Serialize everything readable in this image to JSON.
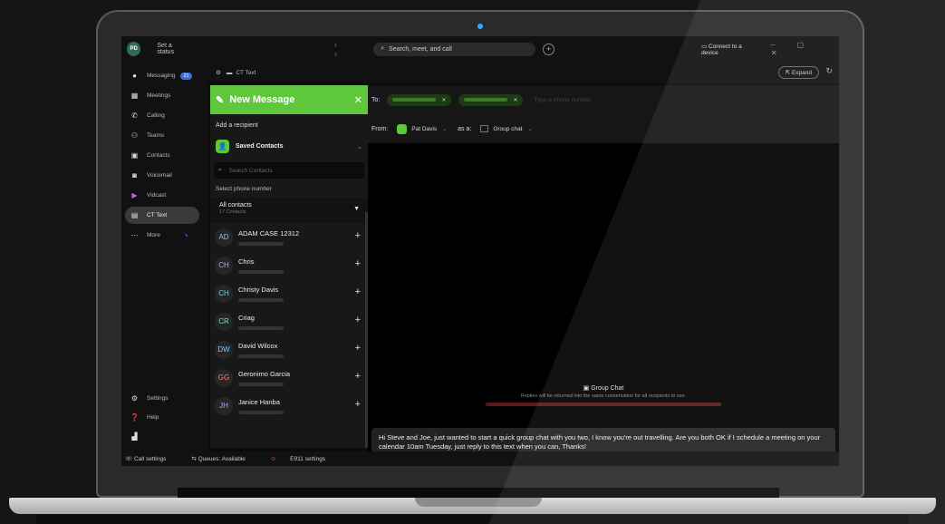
{
  "titlebar": {
    "avatar_initials": "PD",
    "status": "Set a status",
    "search_placeholder": "Search, meet, and call",
    "connect": "Connect to a device"
  },
  "nav": {
    "items": [
      {
        "label": "Messaging",
        "badge": "21"
      },
      {
        "label": "Meetings"
      },
      {
        "label": "Calling"
      },
      {
        "label": "Teams"
      },
      {
        "label": "Contacts"
      },
      {
        "label": "Voicemail"
      },
      {
        "label": "Vidcast"
      },
      {
        "label": "CT Text"
      },
      {
        "label": "More"
      }
    ],
    "settings": "Settings",
    "help": "Help"
  },
  "ctbar": {
    "title": "CT Text",
    "expand": "Expand"
  },
  "panel": {
    "title": "New Message",
    "add_recipient": "Add a recipient",
    "saved_contacts": "Saved Contacts",
    "search_placeholder": "Search Contacts",
    "select_phone": "Select phone number",
    "all_contacts": "All contacts",
    "contacts_count": "17 Contacts",
    "contacts": [
      {
        "initials": "AD",
        "name": "ADAM CASE 12312",
        "color": "#6fd0ff"
      },
      {
        "initials": "CH",
        "name": "Chris",
        "color": "#c79cff"
      },
      {
        "initials": "CH",
        "name": "Christy Davis",
        "color": "#6fd0ff"
      },
      {
        "initials": "CR",
        "name": "Criag",
        "color": "#7fe0c0"
      },
      {
        "initials": "DW",
        "name": "David Wilcox",
        "color": "#6fd0ff"
      },
      {
        "initials": "GG",
        "name": "Geronimo Garcia",
        "color": "#ff8080"
      },
      {
        "initials": "JH",
        "name": "Janice Hanba",
        "color": "#c79cff"
      }
    ]
  },
  "compose": {
    "to_label": "To:",
    "to_placeholder": "Type a phone number",
    "from_label": "From:",
    "from_value": "Pat Davis",
    "as_label": "as a:",
    "as_value": "Group chat",
    "info_title": "Group Chat",
    "info_sub": "Replies will be returned into the same conversation for all recipients to see.",
    "message": "Hi Steve and Joe, just wanted to start a quick group chat with you two, I know you're out travelling.  Are you both OK if I schedule a meeting on your calendar 10am Tuesday, just reply to this text when you can, Thanks!"
  },
  "statusbar": {
    "call_settings": "Call settings",
    "queues": "Queues: Available",
    "e911": "E911 settings"
  },
  "colors": {
    "accent": "#5fc73c",
    "badge": "#3b6ee0"
  }
}
